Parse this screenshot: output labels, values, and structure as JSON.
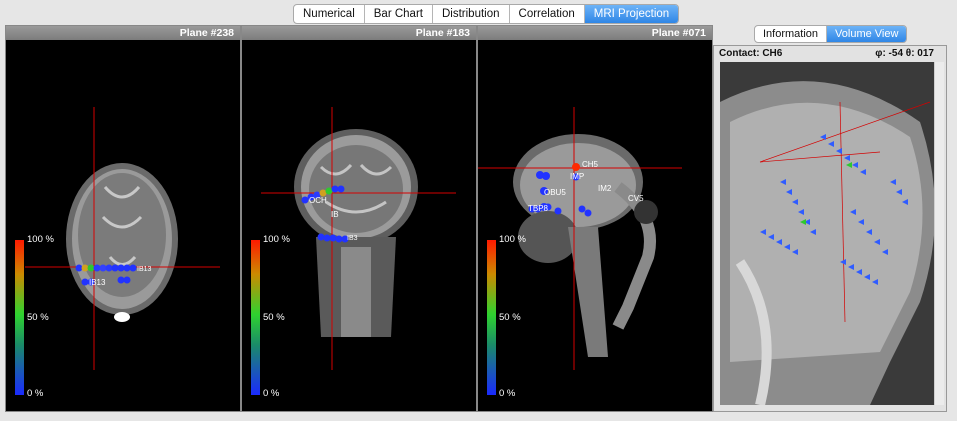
{
  "tabs": [
    "Numerical",
    "Bar Chart",
    "Distribution",
    "Correlation",
    "MRI Projection"
  ],
  "active_tab_index": 4,
  "planes": [
    {
      "title": "Plane #238",
      "view": "axial"
    },
    {
      "title": "Plane #183",
      "view": "coronal"
    },
    {
      "title": "Plane #071",
      "view": "sagittal"
    }
  ],
  "colorbar": {
    "top": "100 %",
    "mid": "50 %",
    "bottom": "0 %",
    "colors": [
      "#ff1a00",
      "#cc8a00",
      "#2fd22f",
      "#1a8a6a",
      "#1a2aff"
    ]
  },
  "electrode_labels": {
    "axial": [
      "IB13",
      "IB13"
    ],
    "coronal": [
      "OCH",
      "IB",
      "IB3"
    ],
    "sagittal": [
      "CH5",
      "IMP",
      "OBU5",
      "IM2",
      "CV5",
      "TBP8"
    ]
  },
  "right_panel": {
    "tabs": [
      "Information",
      "Volume View"
    ],
    "active_tab_index": 1,
    "contact_label": "Contact: CH6",
    "angle_label": "φ: -54 θ: 017"
  },
  "accent_color": "#2f86e6",
  "crosshair_color": "#d40000"
}
